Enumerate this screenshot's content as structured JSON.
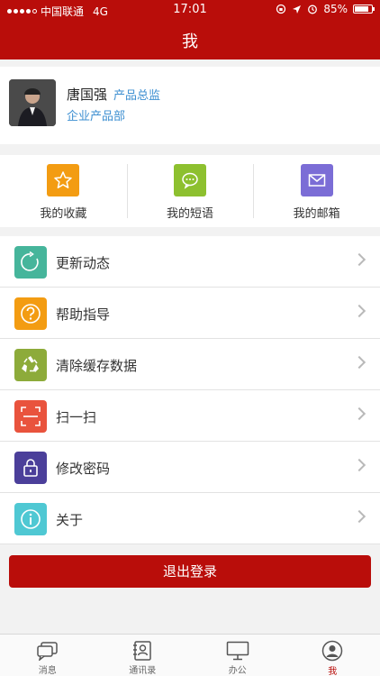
{
  "status": {
    "carrier": "中国联通",
    "network": "4G",
    "time": "17:01",
    "battery": "85%",
    "battery_level": 0.85
  },
  "header": {
    "title": "我"
  },
  "profile": {
    "name": "唐国强",
    "title": "产品总监",
    "department": "企业产品部"
  },
  "shortcuts": [
    {
      "label": "我的收藏",
      "icon": "star-icon",
      "color": "#f39c12"
    },
    {
      "label": "我的短语",
      "icon": "chat-bubble-icon",
      "color": "#8dc02f"
    },
    {
      "label": "我的邮箱",
      "icon": "mail-icon",
      "color": "#7b6dd6"
    }
  ],
  "menu": [
    {
      "label": "更新动态",
      "icon": "refresh-icon",
      "color": "#46b59b"
    },
    {
      "label": "帮助指导",
      "icon": "help-icon",
      "color": "#f39c12"
    },
    {
      "label": "清除缓存数据",
      "icon": "recycle-icon",
      "color": "#8dab3a"
    },
    {
      "label": "扫一扫",
      "icon": "scan-icon",
      "color": "#e9533d"
    },
    {
      "label": "修改密码",
      "icon": "lock-icon",
      "color": "#4b3f9a"
    },
    {
      "label": "关于",
      "icon": "info-icon",
      "color": "#4fc8d3"
    }
  ],
  "logout": {
    "label": "退出登录"
  },
  "tabs": [
    {
      "label": "消息",
      "icon": "message-icon"
    },
    {
      "label": "通讯录",
      "icon": "contacts-icon"
    },
    {
      "label": "办公",
      "icon": "monitor-icon"
    },
    {
      "label": "我",
      "icon": "profile-icon",
      "active": true
    }
  ],
  "colors": {
    "brand": "#b90d0a",
    "link": "#3d8fd1"
  }
}
